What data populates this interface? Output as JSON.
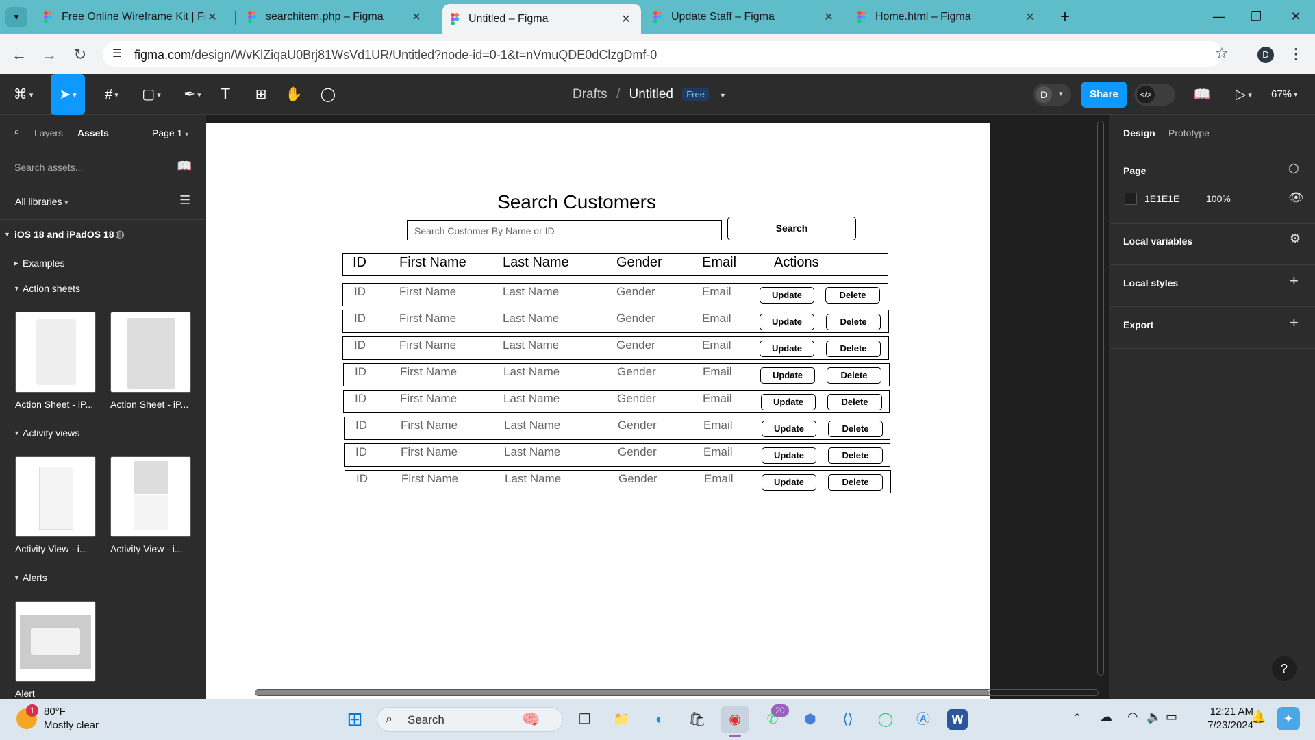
{
  "browser": {
    "tabs": [
      {
        "title": "Free Online Wireframe Kit | Figma",
        "active": false
      },
      {
        "title": "searchitem.php – Figma",
        "active": false
      },
      {
        "title": "Untitled – Figma",
        "active": true
      },
      {
        "title": "Update Staff – Figma",
        "active": false
      },
      {
        "title": "Home.html – Figma",
        "active": false
      }
    ],
    "url_host": "figma.com",
    "url_path": "/design/WvKlZiqaU0Brj81WsVd1UR/Untitled?node-id=0-1&t=nVmuQDE0dClzgDmf-0",
    "profile_initial": "D"
  },
  "figma_toolbar": {
    "breadcrumb_parent": "Drafts",
    "breadcrumb_sep": "/",
    "file_name": "Untitled",
    "plan_badge": "Free",
    "avatar_initial": "D",
    "share_label": "Share",
    "zoom": "67%"
  },
  "left_panel": {
    "tab_layers": "Layers",
    "tab_assets": "Assets",
    "page_selector": "Page 1",
    "search_placeholder": "Search assets...",
    "libraries_label": "All libraries",
    "library_name": "iOS 18 and iPadOS 18",
    "sections": {
      "examples": "Examples",
      "action_sheets": "Action sheets",
      "activity_views": "Activity views",
      "alerts": "Alerts"
    },
    "thumbs": {
      "action_sheet_1": "Action Sheet - iP...",
      "action_sheet_2": "Action Sheet - iP...",
      "activity_view_1": "Activity View - i...",
      "activity_view_2": "Activity View - i...",
      "alert": "Alert"
    }
  },
  "design": {
    "title": "Search Customers",
    "search_placeholder": "Search Customer By Name or ID",
    "search_button": "Search",
    "headers": {
      "id": "ID",
      "first": "First Name",
      "last": "Last Name",
      "gender": "Gender",
      "email": "Email",
      "actions": "Actions"
    },
    "rows": [
      {
        "id": "ID",
        "first": "First Name",
        "last": "Last Name",
        "gender": "Gender",
        "email": "Email",
        "update": "Update",
        "delete": "Delete"
      },
      {
        "id": "ID",
        "first": "First Name",
        "last": "Last Name",
        "gender": "Gender",
        "email": "Email",
        "update": "Update",
        "delete": "Delete"
      },
      {
        "id": "ID",
        "first": "First Name",
        "last": "Last Name",
        "gender": "Gender",
        "email": "Email",
        "update": "Update",
        "delete": "Delete"
      },
      {
        "id": "ID",
        "first": "First Name",
        "last": "Last Name",
        "gender": "Gender",
        "email": "Email",
        "update": "Update",
        "delete": "Delete"
      },
      {
        "id": "ID",
        "first": "First Name",
        "last": "Last Name",
        "gender": "Gender",
        "email": "Email",
        "update": "Update",
        "delete": "Delete"
      },
      {
        "id": "ID",
        "first": "First Name",
        "last": "Last Name",
        "gender": "Gender",
        "email": "Email",
        "update": "Update",
        "delete": "Delete"
      },
      {
        "id": "ID",
        "first": "First Name",
        "last": "Last Name",
        "gender": "Gender",
        "email": "Email",
        "update": "Update",
        "delete": "Delete"
      },
      {
        "id": "ID",
        "first": "First Name",
        "last": "Last Name",
        "gender": "Gender",
        "email": "Email",
        "update": "Update",
        "delete": "Delete"
      }
    ]
  },
  "right_panel": {
    "tab_design": "Design",
    "tab_prototype": "Prototype",
    "page_heading": "Page",
    "page_color": "1E1E1E",
    "page_opacity": "100%",
    "local_variables": "Local variables",
    "local_styles": "Local styles",
    "export": "Export",
    "help": "?"
  },
  "taskbar": {
    "weather_temp": "80°F",
    "weather_desc": "Mostly clear",
    "weather_badge": "1",
    "search_label": "Search",
    "whatsapp_badge": "20",
    "time": "12:21 AM",
    "date": "7/23/2024"
  },
  "colors": {
    "tab_strip": "#5fbcc9",
    "figma_accent": "#0d99ff",
    "canvas_bg": "#1e1e1e"
  }
}
